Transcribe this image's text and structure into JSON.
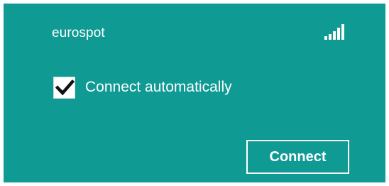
{
  "network": {
    "name": "eurospot",
    "signal_icon": "signal-strength-icon",
    "signal_bars_filled": 5,
    "signal_bars_total": 5
  },
  "connect_automatically": {
    "label": "Connect automatically",
    "checked": true,
    "check_icon": "checkmark-icon"
  },
  "actions": {
    "connect_label": "Connect"
  },
  "colors": {
    "panel_background": "#0f9a94",
    "text": "#ffffff",
    "checkbox_background": "#ffffff",
    "checkmark": "#111111"
  }
}
